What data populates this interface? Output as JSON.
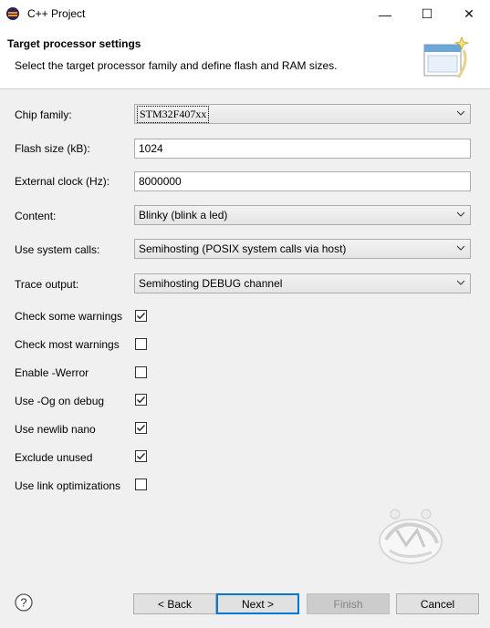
{
  "window": {
    "title": "C++ Project",
    "minimize": "—",
    "maximize": "☐",
    "close": "✕"
  },
  "header": {
    "title": "Target processor settings",
    "description": "Select the target processor family and define flash and RAM sizes."
  },
  "form": {
    "chip_family": {
      "label": "Chip family:",
      "value": "STM32F407xx"
    },
    "flash_size": {
      "label": "Flash size (kB):",
      "value": "1024"
    },
    "external_clock": {
      "label": "External clock (Hz):",
      "value": "8000000"
    },
    "content": {
      "label": "Content:",
      "value": "Blinky (blink a led)"
    },
    "system_calls": {
      "label": "Use system calls:",
      "value": "Semihosting (POSIX system calls via host)"
    },
    "trace_output": {
      "label": "Trace output:",
      "value": "Semihosting DEBUG channel"
    },
    "checkboxes": [
      {
        "label": "Check some warnings",
        "checked": true
      },
      {
        "label": "Check most warnings",
        "checked": false
      },
      {
        "label": "Enable -Werror",
        "checked": false
      },
      {
        "label": "Use -Og on debug",
        "checked": true
      },
      {
        "label": "Use newlib nano",
        "checked": true
      },
      {
        "label": "Exclude unused",
        "checked": true
      },
      {
        "label": "Use link optimizations",
        "checked": false
      }
    ]
  },
  "footer": {
    "help_icon": "?",
    "back": "< Back",
    "next": "Next >",
    "finish": "Finish",
    "cancel": "Cancel"
  }
}
